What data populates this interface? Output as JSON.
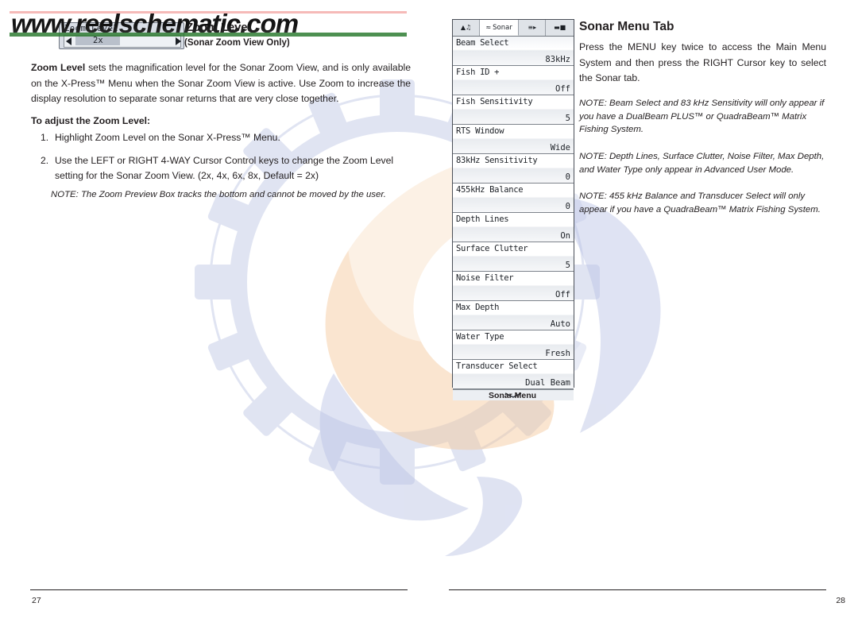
{
  "watermark": {
    "text": "www.reelschematic.com"
  },
  "left_page": {
    "folio": "27",
    "heading": "Zoom Level",
    "subhead": "(Sonar Zoom View Only)",
    "paragraph": "Zoom Level sets the magnification level for the Sonar Zoom View, and is only available on the X-Press™ Menu when the Sonar Zoom View is active. Use Zoom to increase the display resolution to separate sonar returns that are very close together.",
    "paragraph_lead": "Zoom Level",
    "subhead_bold": "To adjust the Zoom Level:",
    "steps": [
      {
        "num": "1.",
        "text": "Highlight Zoom Level on the Sonar X-Press™ Menu."
      },
      {
        "num": "2.",
        "text": "Use the LEFT or RIGHT 4-WAY Cursor Control keys to change the Zoom Level setting for the Sonar Zoom View. (2x, 4x, 6x, 8x, Default = 2x)"
      }
    ],
    "note": "NOTE: The Zoom Preview Box tracks the bottom and cannot be moved by the user.",
    "zoom_widget": {
      "label": "Zoom Level",
      "value": "2x",
      "left_arrow": "left-arrow-icon",
      "right_arrow": "right-arrow-icon"
    }
  },
  "right_page": {
    "folio": "28",
    "heading": "Sonar Menu Tab",
    "paragraph": "Press the MENU key twice to access the Main Menu System and then press the RIGHT Cursor key to select the Sonar tab.",
    "notes": [
      "NOTE: Beam Select and 83 kHz Sensitivity will only appear if you have a DualBeam PLUS™ or QuadraBeam™ Matrix Fishing System.",
      "NOTE: Depth Lines, Surface Clutter, Noise Filter, Max Depth, and Water Type only appear in Advanced User Mode.",
      "NOTE: 455 kHz Balance and Transducer Select will only appear if you have a QuadraBeam™ Matrix Fishing System."
    ],
    "device": {
      "caption": "Sonar Menu",
      "tabs": [
        {
          "label": "",
          "icon": "alarm-bell-icon",
          "active": false
        },
        {
          "label": "Sonar",
          "icon": "sonar-icon",
          "active": true
        },
        {
          "label": "",
          "icon": "settings-sliders-icon",
          "active": false
        },
        {
          "label": "",
          "icon": "display-screen-icon",
          "active": false
        }
      ],
      "menu_items": [
        {
          "label": "Beam Select",
          "value": "83kHz"
        },
        {
          "label": "Fish ID +",
          "value": "Off"
        },
        {
          "label": "Fish Sensitivity",
          "value": "5"
        },
        {
          "label": "RTS Window",
          "value": "Wide"
        },
        {
          "label": "83kHz Sensitivity",
          "value": "0"
        },
        {
          "label": "455kHz Balance",
          "value": "0"
        },
        {
          "label": "Depth Lines",
          "value": "On"
        },
        {
          "label": "Surface Clutter",
          "value": "5"
        },
        {
          "label": "Noise Filter",
          "value": "Off"
        },
        {
          "label": "Max Depth",
          "value": "Auto"
        },
        {
          "label": "Water Type",
          "value": "Fresh"
        },
        {
          "label": "Transducer Select",
          "value": "Dual Beam"
        }
      ],
      "scroll_hint": "scroll-down-icon"
    }
  }
}
